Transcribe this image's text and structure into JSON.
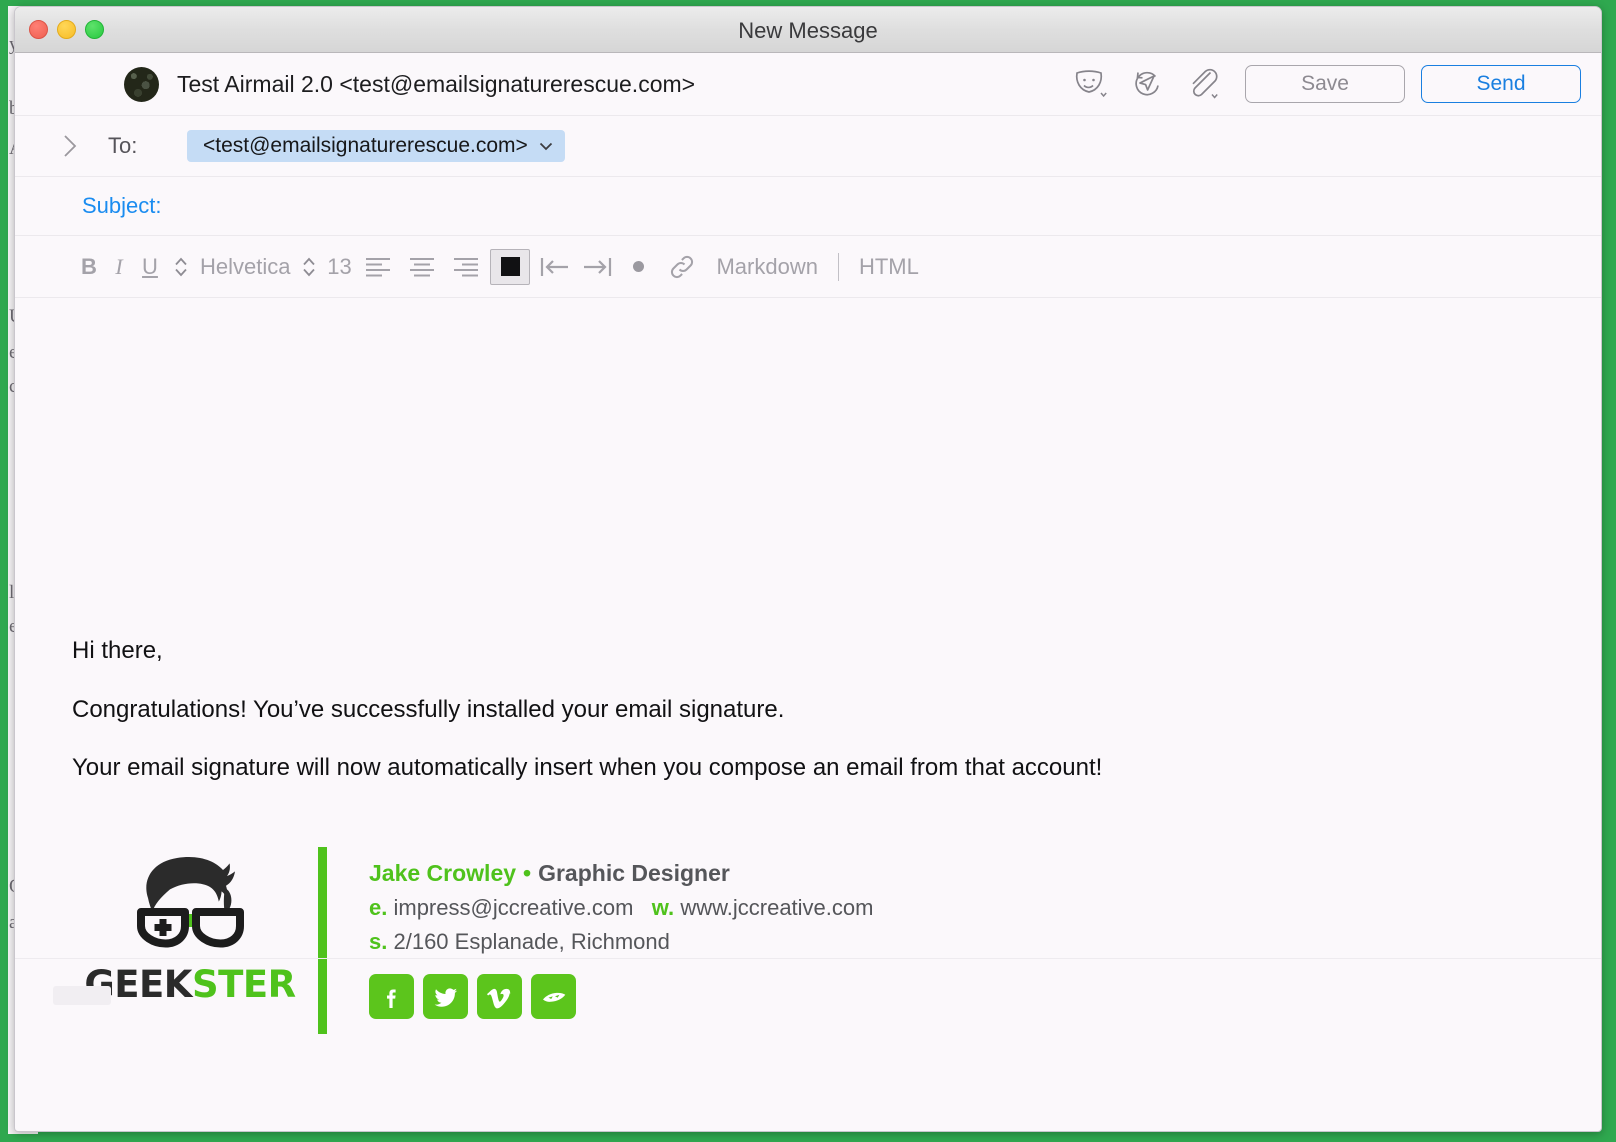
{
  "window": {
    "title": "New Message",
    "traffic_lights": [
      "close",
      "minimize",
      "zoom"
    ]
  },
  "from_row": {
    "from_address": "Test Airmail 2.0 <test@emailsignaturerescue.com>",
    "icons": [
      "emoji-mask-icon",
      "send-later-icon",
      "attachment-icon"
    ],
    "save_label": "Save",
    "send_label": "Send"
  },
  "to_row": {
    "label": "To:",
    "recipient": "<test@emailsignaturerescue.com>",
    "caret": "⌄"
  },
  "subject_row": {
    "label": "Subject:",
    "value": "",
    "placeholder": ""
  },
  "format_bar": {
    "bold": "B",
    "italic": "I",
    "underline": "U",
    "font_family": "Helvetica",
    "font_size": "13",
    "markdown": "Markdown",
    "html": "HTML",
    "separator": "|",
    "stepper_glyph": "⇅",
    "color_swatch": "#111113"
  },
  "message": {
    "greeting": "Hi there,",
    "congrats": "Congratulations! You’ve successfully installed your email signature.",
    "autoinsert": "Your email signature will now automatically insert when you compose an email from that account!"
  },
  "signature": {
    "logo_text_dark": "GEEK",
    "logo_text_green": "STER",
    "name": "Jake Crowley",
    "separator_dot": "•",
    "job_title": "Graphic Designer",
    "email_key": "e.",
    "email_value": "impress@jccreative.com",
    "web_key": "w.",
    "web_value": "www.jccreative.com",
    "street_key": "s.",
    "street_value": "2/160 Esplanade, Richmond",
    "accent_color": "#4fc21c",
    "socials": [
      {
        "name": "facebook",
        "glyph": "f"
      },
      {
        "name": "twitter",
        "glyph": "t"
      },
      {
        "name": "vimeo",
        "glyph": "v"
      },
      {
        "name": "behance",
        "glyph": "b"
      }
    ]
  },
  "background": {
    "fragments": [
      "y",
      "b",
      "A",
      "U",
      "e",
      "c",
      "l",
      "e",
      "O",
      "a"
    ]
  },
  "colors": {
    "page_border": "#2fa84f",
    "accent_blue": "#1a7fe0",
    "window_bg": "#fbf8fb",
    "titlebar_bg": "#dfdfdf"
  }
}
